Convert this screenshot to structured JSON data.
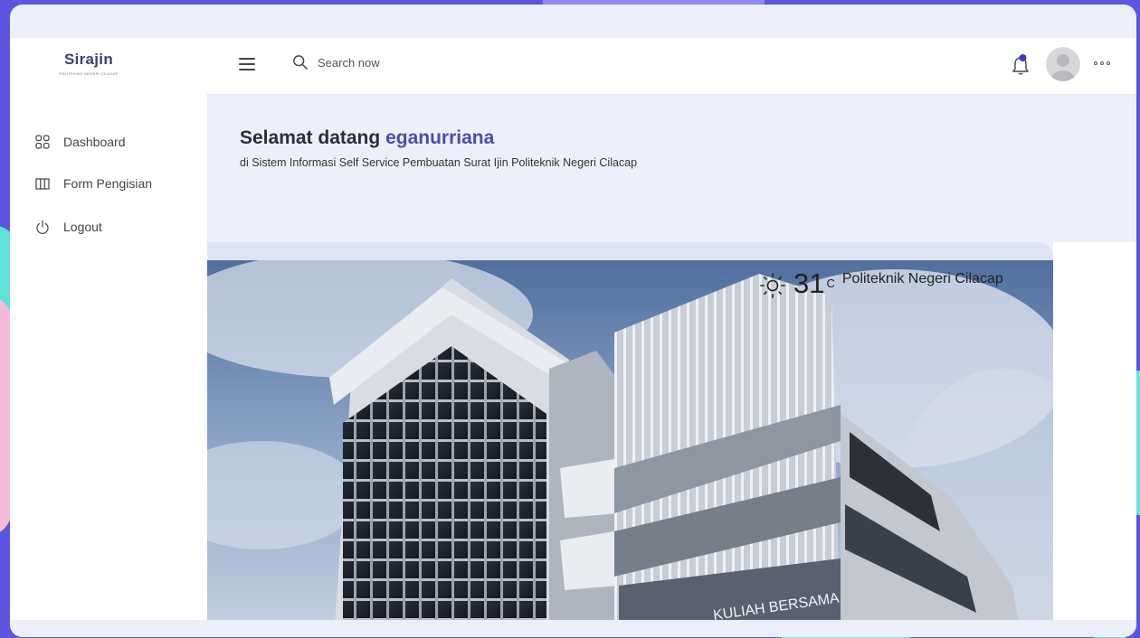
{
  "app": {
    "logo_text": "Sirajin",
    "logo_subtitle": "POLITEKNIK NEGERI CILACAP"
  },
  "topbar": {
    "search_placeholder": "Search now",
    "icons": [
      "menu-icon",
      "search-icon",
      "bell-icon",
      "avatar",
      "more-icon"
    ],
    "notification_color": "#3d3fb5"
  },
  "sidebar": {
    "items": [
      {
        "label": "Dashboard",
        "icon": "grid-icon"
      },
      {
        "label": "Form Pengisian",
        "icon": "columns-icon"
      },
      {
        "label": "Logout",
        "icon": "power-icon"
      }
    ]
  },
  "main": {
    "greeting": "Selamat datang",
    "username": "eganurriana",
    "subtitle": "di Sistem Informasi Self Service Pembuatan Surat Ijin Politeknik Negeri Cilacap"
  },
  "weather": {
    "icon": "sun-icon",
    "temperature": "31",
    "unit": "C",
    "location": "Politeknik Negeri Cilacap"
  },
  "building_sign": "KULIAH BERSAMA",
  "colors": {
    "accent": "#4b4bb0",
    "background": "#5b55e0",
    "panel": "#edf0fa"
  }
}
